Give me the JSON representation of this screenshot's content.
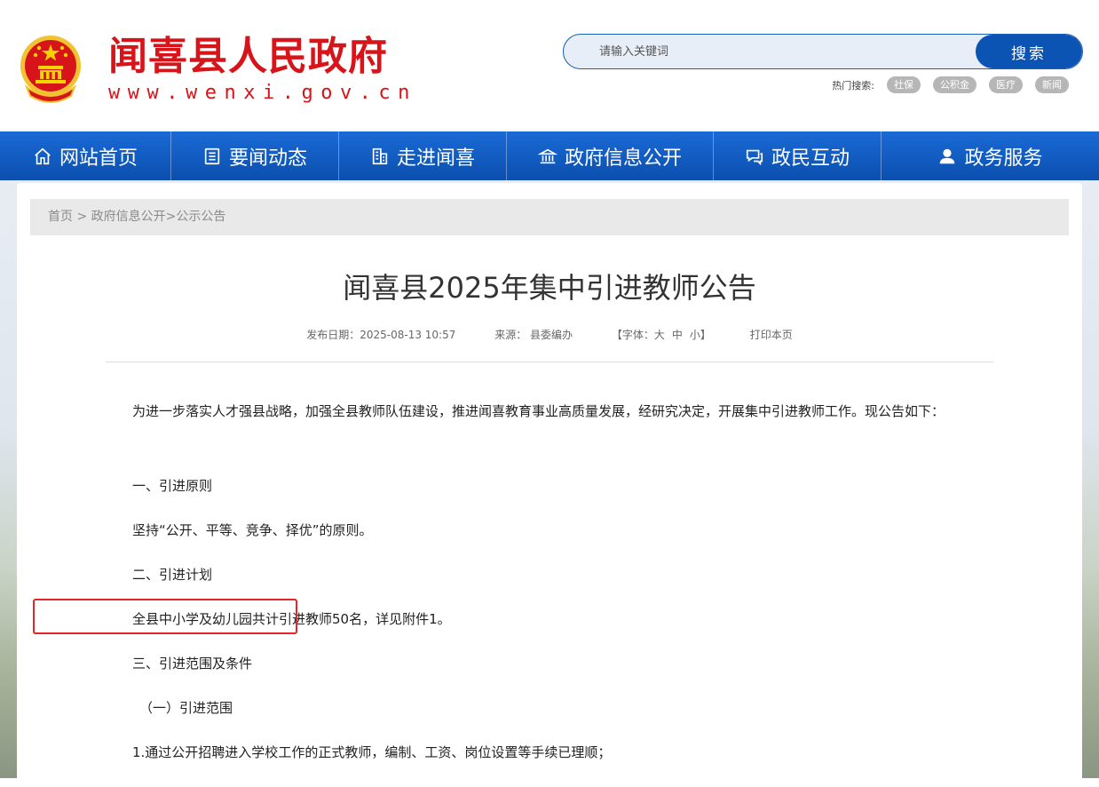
{
  "header": {
    "site_title": "闻喜县人民政府",
    "site_domain": "www.wenxi.gov.cn",
    "search": {
      "placeholder": "请输入关键词",
      "button_label": "搜索"
    },
    "hot_search": {
      "label": "热门搜索:",
      "tags": [
        "社保",
        "公积金",
        "医疗",
        "新闻"
      ]
    }
  },
  "nav": {
    "items": [
      {
        "label": "网站首页",
        "icon": "home-icon"
      },
      {
        "label": "要闻动态",
        "icon": "document-icon"
      },
      {
        "label": "走进闻喜",
        "icon": "building-icon"
      },
      {
        "label": "政府信息公开",
        "icon": "government-icon"
      },
      {
        "label": "政民互动",
        "icon": "chat-icon"
      },
      {
        "label": "政务服务",
        "icon": "user-icon"
      }
    ]
  },
  "breadcrumb": {
    "home": "首页",
    "sep1": " > ",
    "section": "政府信息公开",
    "sep2": ">",
    "current": "公示公告"
  },
  "article": {
    "title": "闻喜县2025年集中引进教师公告",
    "meta": {
      "date": "发布日期：2025-08-13 10:57",
      "source": "来源： 县委编办",
      "font_prefix": "【字体：",
      "font_large": "大",
      "font_medium": "中",
      "font_small": "小",
      "font_suffix": "】",
      "print": "打印本页"
    },
    "paragraphs": [
      "为进一步落实人才强县战略，加强全县教师队伍建设，推进闻喜教育事业高质量发展，经研究决定，开展集中引进教师工作。现公告如下：",
      "一、引进原则",
      "坚持“公开、平等、竞争、择优”的原则。",
      "二、引进计划",
      "全县中小学及幼儿园共计引进教师50名，详见附件1。",
      "三、引进范围及条件",
      "（一）引进范围",
      "1.通过公开招聘进入学校工作的正式教师，编制、工资、岗位设置等手续已理顺；"
    ]
  },
  "colors": {
    "brand_red": "#d7141a",
    "nav_blue": "#0b4fae",
    "highlight": "#e3262a"
  }
}
